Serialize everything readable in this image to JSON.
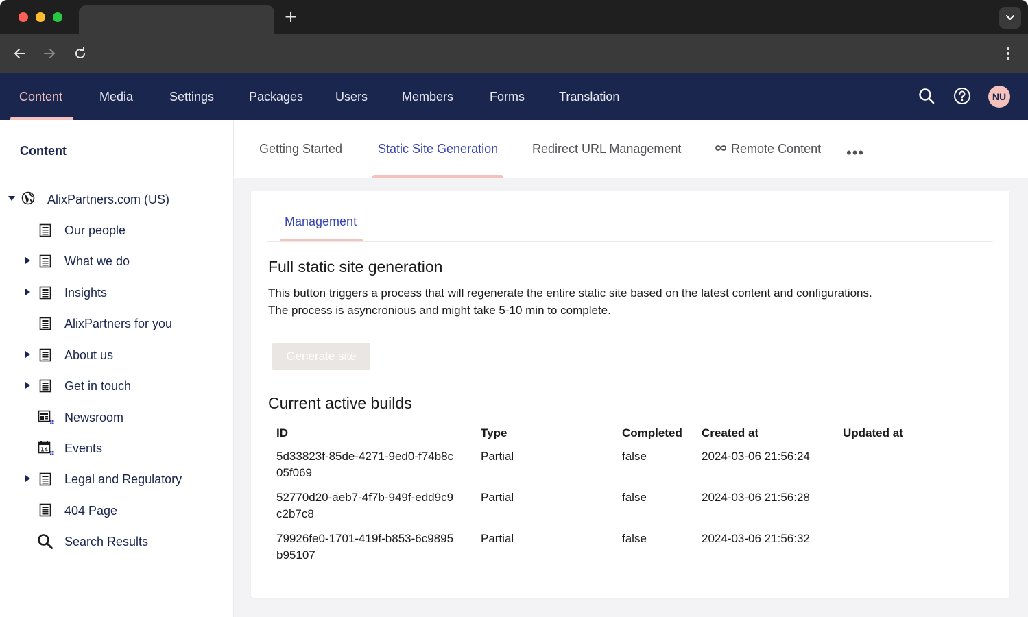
{
  "browser": {
    "new_tab_label": "+"
  },
  "header": {
    "nav": [
      {
        "label": "Content"
      },
      {
        "label": "Media"
      },
      {
        "label": "Settings"
      },
      {
        "label": "Packages"
      },
      {
        "label": "Users"
      },
      {
        "label": "Members"
      },
      {
        "label": "Forms"
      },
      {
        "label": "Translation"
      }
    ],
    "avatar_initials": "NU"
  },
  "sidebar": {
    "title": "Content",
    "root": {
      "label": "AlixPartners.com (US)",
      "icon": "globe-icon"
    },
    "items": [
      {
        "label": "Our people",
        "icon": "document-icon",
        "expandable": false
      },
      {
        "label": "What we do",
        "icon": "document-icon",
        "expandable": true
      },
      {
        "label": "Insights",
        "icon": "document-icon",
        "expandable": true
      },
      {
        "label": "AlixPartners for you",
        "icon": "document-icon",
        "expandable": false
      },
      {
        "label": "About us",
        "icon": "document-icon",
        "expandable": true
      },
      {
        "label": "Get in touch",
        "icon": "document-icon",
        "expandable": true
      },
      {
        "label": "Newsroom",
        "icon": "newsroom-icon",
        "expandable": false
      },
      {
        "label": "Events",
        "icon": "calendar-icon",
        "expandable": false
      },
      {
        "label": "Legal and Regulatory",
        "icon": "document-icon",
        "expandable": true
      },
      {
        "label": "404 Page",
        "icon": "document-icon",
        "expandable": false
      },
      {
        "label": "Search Results",
        "icon": "search-icon",
        "expandable": false
      }
    ]
  },
  "dashboard_tabs": [
    {
      "label": "Getting Started"
    },
    {
      "label": "Static Site Generation"
    },
    {
      "label": "Redirect URL Management"
    },
    {
      "label": "Remote Content"
    }
  ],
  "more_label": "•••",
  "panel": {
    "tab_label": "Management",
    "heading": "Full static site generation",
    "description_line1": "This button triggers a process that will regenerate the entire static site based on the latest content and configurations.",
    "description_line2": "The process is asyncronious and might take 5-10 min to complete.",
    "generate_button": "Generate site",
    "builds_heading": "Current active builds",
    "table": {
      "headers": [
        "ID",
        "Type",
        "Completed",
        "Created at",
        "Updated at"
      ],
      "rows": [
        {
          "id": "5d33823f-85de-4271-9ed0-f74b8c05f069",
          "type": "Partial",
          "completed": "false",
          "created": "2024-03-06 21:56:24",
          "updated": ""
        },
        {
          "id": "52770d20-aeb7-4f7b-949f-edd9c9c2b7c8",
          "type": "Partial",
          "completed": "false",
          "created": "2024-03-06 21:56:28",
          "updated": ""
        },
        {
          "id": "79926fe0-1701-419f-b853-6c9895b95107",
          "type": "Partial",
          "completed": "false",
          "created": "2024-03-06 21:56:32",
          "updated": ""
        }
      ]
    }
  },
  "colors": {
    "header_bg": "#1b264f",
    "accent_pink": "#f5c1bc",
    "link_blue": "#3544b1"
  }
}
